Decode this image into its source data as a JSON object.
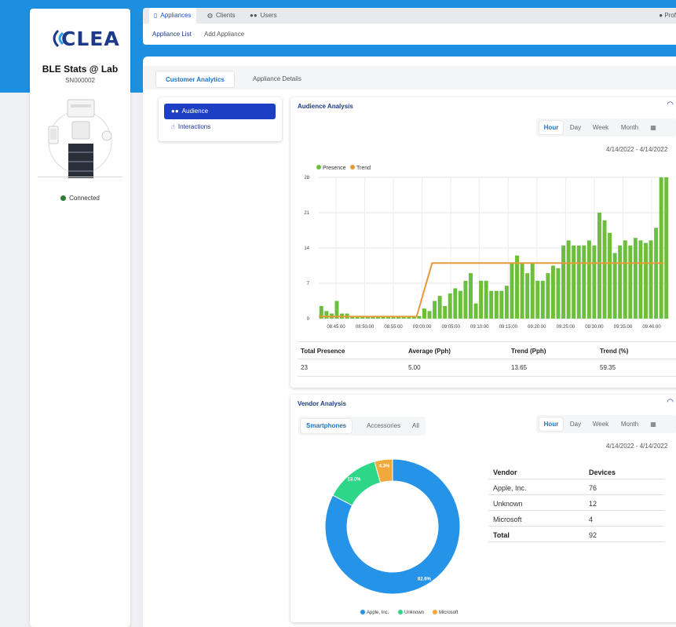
{
  "colors": {
    "brand_blue": "#1c8fe0",
    "presence_green": "#6bbf3a",
    "trend_orange": "#e59a3a",
    "apple": "#2493e8",
    "unknown": "#2ed688",
    "microsoft": "#f2a93b",
    "connected": "#2e7d32",
    "nav_blue": "#1d3fc4"
  },
  "sidebar": {
    "logo_text": "CLEA",
    "device_name": "BLE Stats @ Lab",
    "device_serial": "SN000002",
    "status": "Connected"
  },
  "nav": {
    "tabs": [
      {
        "label": "Appliances",
        "icon": "tablet-icon"
      },
      {
        "label": "Clients",
        "icon": "globe-icon"
      },
      {
        "label": "Users",
        "icon": "users-icon"
      }
    ],
    "profile_label": "Prof",
    "sub_links": [
      "Appliance List",
      "Add Appliance"
    ]
  },
  "content": {
    "tabs": [
      "Customer Analytics",
      "Appliance Details"
    ],
    "menu": [
      {
        "label": "Audience",
        "icon": "users-icon"
      },
      {
        "label": "Interactions",
        "icon": "hand-pointer-icon"
      }
    ]
  },
  "audience": {
    "title": "Audience Analysis",
    "periods": [
      "Hour",
      "Day",
      "Week",
      "Month"
    ],
    "date_range": "4/14/2022 - 4/14/2022",
    "stats_headers": [
      "Total Presence",
      "Average (Pph)",
      "Trend (Pph)",
      "Trend (%)"
    ],
    "stats_values": [
      "23",
      "5.00",
      "13.65",
      "59.35"
    ]
  },
  "vendor": {
    "title": "Vendor Analysis",
    "tabs": [
      "Smartphones",
      "Accessories",
      "All"
    ],
    "periods": [
      "Hour",
      "Day",
      "Week",
      "Month"
    ],
    "date_range": "4/14/2022 - 4/14/2022",
    "table_headers": [
      "Vendor",
      "Devices"
    ],
    "rows": [
      {
        "vendor": "Apple, Inc.",
        "devices": "76"
      },
      {
        "vendor": "Unknown",
        "devices": "12"
      },
      {
        "vendor": "Microsoft",
        "devices": "4"
      },
      {
        "vendor": "Total",
        "devices": "92"
      }
    ]
  },
  "chart_data": [
    {
      "type": "bar",
      "legend": [
        "Presence",
        "Trend"
      ],
      "legend_position": "top-left",
      "ylim": [
        0,
        28
      ],
      "yticks": [
        "0",
        "7",
        "14",
        "21",
        "28"
      ],
      "xticks": [
        "08:45:00",
        "08:50:00",
        "08:55:00",
        "09:00:00",
        "09:05:00",
        "09:10:00",
        "09:15:00",
        "09:20:00",
        "09:25:00",
        "09:30:00",
        "09:35:00",
        "09:40:00"
      ],
      "grid": true,
      "series": [
        {
          "name": "Presence",
          "type": "bar",
          "values": [
            2.5,
            1.5,
            1,
            3.5,
            1,
            1,
            0.5,
            0.5,
            0.5,
            0.5,
            0.5,
            0.5,
            0.5,
            0.5,
            0.5,
            0.5,
            0.5,
            0.5,
            0.5,
            0.5,
            2,
            1.5,
            3.5,
            4.5,
            2.5,
            5,
            6,
            5.5,
            7.5,
            9,
            3,
            7.5,
            7.5,
            5.5,
            5.5,
            5.5,
            6.5,
            11,
            12.5,
            11,
            9,
            11,
            7.5,
            7.5,
            9,
            10.5,
            10,
            14.5,
            15.5,
            14.5,
            14.5,
            14.5,
            15.5,
            14.5,
            21,
            19.5,
            17,
            13,
            14.5,
            15.5,
            14.5,
            16,
            15.5,
            15,
            15.5,
            18,
            28,
            28
          ]
        },
        {
          "name": "Trend",
          "type": "line",
          "points": [
            [
              0,
              0.4
            ],
            [
              19,
              0.4
            ],
            [
              22,
              11
            ],
            [
              67,
              11
            ]
          ]
        }
      ]
    },
    {
      "type": "pie",
      "style": "donut",
      "labels": [
        "Apple, Inc.",
        "Unknown",
        "Microsoft"
      ],
      "values": [
        82.6,
        13.0,
        4.3
      ],
      "value_labels": [
        "82.6%",
        "13.0%",
        "4.3%"
      ],
      "legend": [
        "Apple, Inc.",
        "Unknown",
        "Microsoft"
      ],
      "legend_position": "bottom"
    }
  ]
}
